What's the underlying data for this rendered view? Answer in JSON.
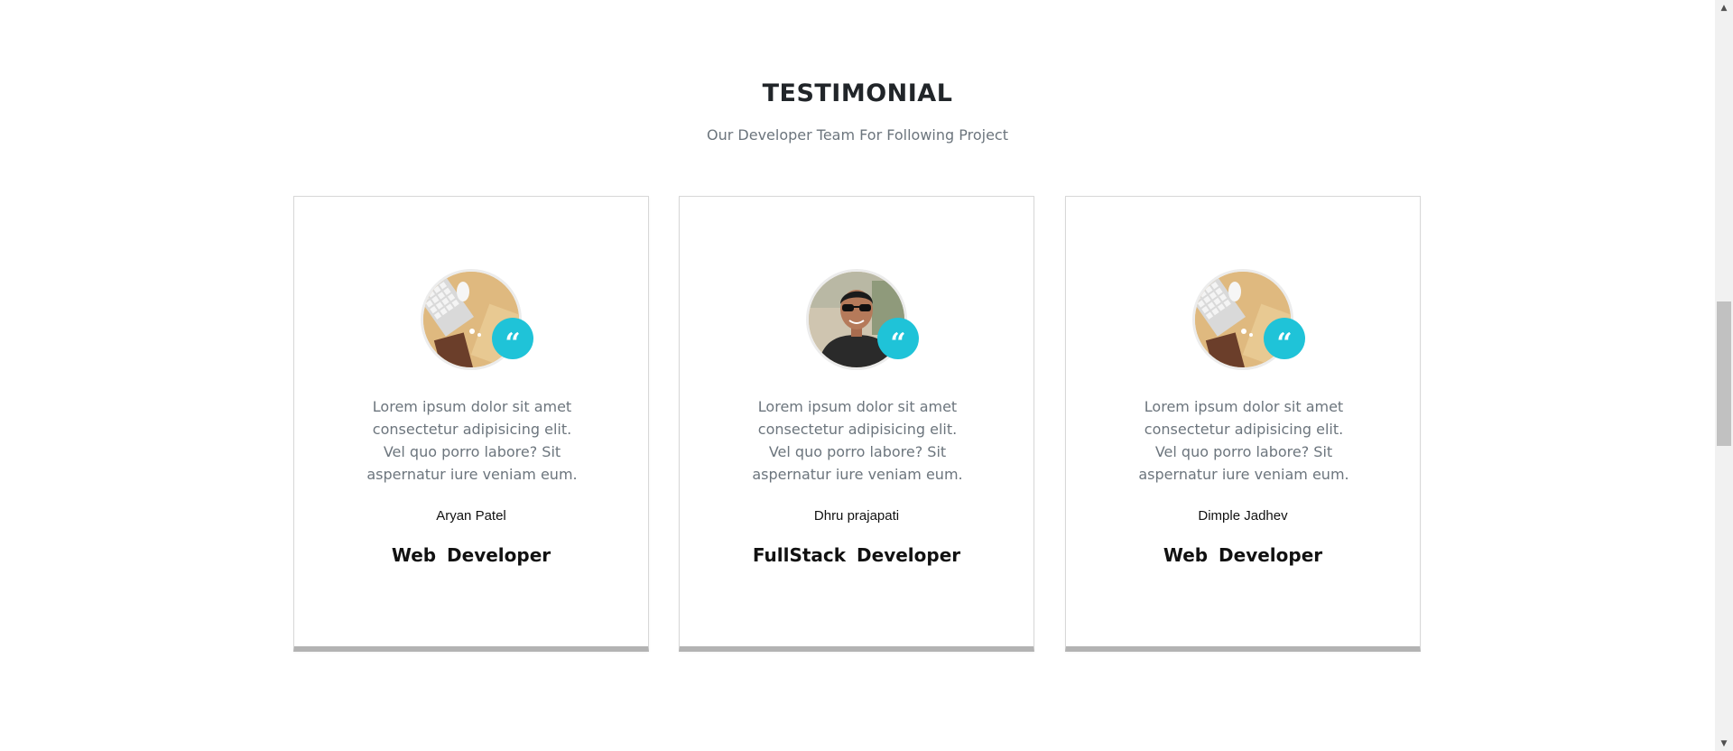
{
  "section": {
    "title": "TESTIMONIAL",
    "subtitle": "Our Developer Team For Following Project"
  },
  "cards": [
    {
      "quote": "Lorem ipsum dolor sit amet consectetur adipisicing elit. Vel quo porro labore? Sit aspernatur iure veniam eum.",
      "name": "Aryan Patel",
      "role": "Web  Developer",
      "avatar_icon": "desk-photo",
      "quote_icon": "quote-icon"
    },
    {
      "quote": "Lorem ipsum dolor sit amet consectetur adipisicing elit. Vel quo porro labore? Sit aspernatur iure veniam eum.",
      "name": "Dhru prajapati",
      "role": "FullStack  Developer",
      "avatar_icon": "person-photo",
      "quote_icon": "quote-icon"
    },
    {
      "quote": "Lorem ipsum dolor sit amet consectetur adipisicing elit. Vel quo porro labore? Sit aspernatur iure veniam eum.",
      "name": "Dimple Jadhev",
      "role": "Web  Developer",
      "avatar_icon": "desk-photo",
      "quote_icon": "quote-icon"
    }
  ],
  "quote_glyph": "“",
  "colors": {
    "accent": "#1fc3d8",
    "card_border_bottom": "#b3b3b3",
    "title": "#212529",
    "muted_text": "#6c757d"
  },
  "scrollbar": {
    "up_glyph": "▲",
    "down_glyph": "▼"
  }
}
